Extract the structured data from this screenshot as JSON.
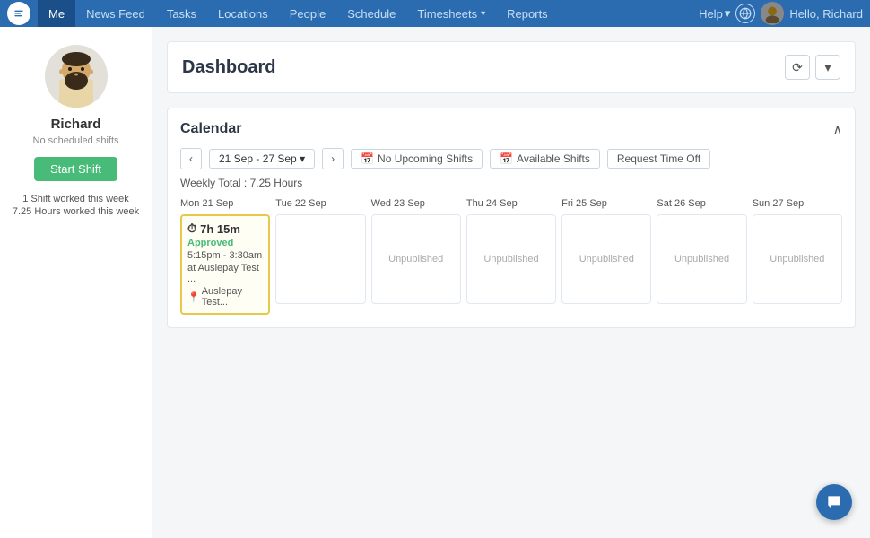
{
  "topnav": {
    "logo_label": "Deputy",
    "items": [
      {
        "id": "me",
        "label": "Me",
        "active": true,
        "has_dropdown": false
      },
      {
        "id": "newsfeed",
        "label": "News Feed",
        "active": false,
        "has_dropdown": false
      },
      {
        "id": "tasks",
        "label": "Tasks",
        "active": false,
        "has_dropdown": false
      },
      {
        "id": "locations",
        "label": "Locations",
        "active": false,
        "has_dropdown": false
      },
      {
        "id": "people",
        "label": "People",
        "active": false,
        "has_dropdown": false
      },
      {
        "id": "schedule",
        "label": "Schedule",
        "active": false,
        "has_dropdown": false
      },
      {
        "id": "timesheets",
        "label": "Timesheets",
        "active": false,
        "has_dropdown": true
      },
      {
        "id": "reports",
        "label": "Reports",
        "active": false,
        "has_dropdown": false
      }
    ],
    "help_label": "Help",
    "hello_label": "Hello, Richard"
  },
  "sidebar": {
    "name": "Richard",
    "subtitle": "No scheduled shifts",
    "start_shift_label": "Start Shift",
    "stats": [
      {
        "label": "1 Shift worked this week"
      },
      {
        "label": "7.25 Hours worked this week"
      }
    ]
  },
  "dashboard": {
    "title": "Dashboard",
    "refresh_btn": "⟳",
    "dropdown_btn": "▾"
  },
  "calendar": {
    "title": "Calendar",
    "weekly_total": "Weekly Total : 7.25 Hours",
    "date_range": "21 Sep - 27 Sep",
    "buttons": [
      {
        "id": "no-upcoming",
        "label": "No Upcoming Shifts",
        "icon": "calendar"
      },
      {
        "id": "available",
        "label": "Available Shifts",
        "icon": "calendar"
      },
      {
        "id": "request-time-off",
        "label": "Request Time Off"
      }
    ],
    "days": [
      {
        "id": "mon",
        "header": "Mon 21 Sep",
        "today": false,
        "shift": {
          "has_shift": true,
          "duration": "7h 15m",
          "status": "Approved",
          "time": "5:15pm - 3:30am",
          "location_line1": "at Auslepay Test ...",
          "location_line2": "Auslepay Test..."
        }
      },
      {
        "id": "tue",
        "header": "Tue 22 Sep",
        "today": true,
        "shift": null
      },
      {
        "id": "wed",
        "header": "Wed 23 Sep",
        "today": false,
        "shift": null,
        "label": "Unpublished"
      },
      {
        "id": "thu",
        "header": "Thu 24 Sep",
        "today": false,
        "shift": null,
        "label": "Unpublished"
      },
      {
        "id": "fri",
        "header": "Fri 25 Sep",
        "today": false,
        "shift": null,
        "label": "Unpublished"
      },
      {
        "id": "sat",
        "header": "Sat 26 Sep",
        "today": false,
        "shift": null,
        "label": "Unpublished"
      },
      {
        "id": "sun",
        "header": "Sun 27 Sep",
        "today": false,
        "shift": null,
        "label": "Unpublished"
      }
    ]
  }
}
